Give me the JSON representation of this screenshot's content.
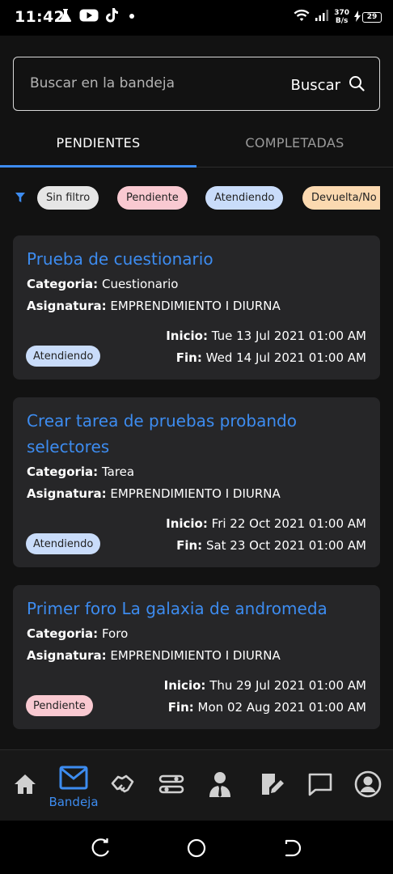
{
  "status_bar": {
    "time": "11:42",
    "net_speed_value": "370",
    "net_speed_unit": "B/s",
    "battery": "29",
    "icons": [
      "flask-icon",
      "youtube-icon",
      "tiktok-icon",
      "dot-icon",
      "wifi-icon",
      "signal-icon",
      "charging-icon",
      "battery-icon"
    ]
  },
  "search": {
    "placeholder": "Buscar en la bandeja",
    "button_label": "Buscar"
  },
  "tabs": [
    {
      "label": "PENDIENTES",
      "active": true
    },
    {
      "label": "COMPLETADAS",
      "active": false
    }
  ],
  "filters": [
    {
      "label": "Sin filtro",
      "color": "#e6e6e6"
    },
    {
      "label": "Pendiente",
      "color": "#f9c9d1"
    },
    {
      "label": "Atendiendo",
      "color": "#c9dcfa"
    },
    {
      "label": "Devuelta/No r",
      "color": "#fbd9b0"
    }
  ],
  "labels": {
    "categoria": "Categoria:",
    "asignatura": "Asignatura:",
    "inicio": "Inicio:",
    "fin": "Fin:"
  },
  "cards": [
    {
      "title": "Prueba de cuestionario",
      "categoria": "Cuestionario",
      "asignatura": "EMPRENDIMIENTO I DIURNA",
      "inicio": "Tue 13 Jul 2021 01:00 AM",
      "fin": "Wed 14 Jul 2021 01:00 AM",
      "status": "Atendiendo",
      "status_color": "#c9dcfa"
    },
    {
      "title": "Crear tarea de pruebas probando selectores",
      "categoria": "Tarea",
      "asignatura": "EMPRENDIMIENTO I DIURNA",
      "inicio": "Fri 22 Oct 2021 01:00 AM",
      "fin": "Sat 23 Oct 2021 01:00 AM",
      "status": "Atendiendo",
      "status_color": "#c9dcfa"
    },
    {
      "title": "Primer foro La galaxia de andromeda",
      "categoria": "Foro",
      "asignatura": "EMPRENDIMIENTO I DIURNA",
      "inicio": "Thu 29 Jul 2021 01:00 AM",
      "fin": "Mon 02 Aug 2021 01:00 AM",
      "status": "Pendiente",
      "status_color": "#f9c9d1"
    }
  ],
  "bottom_nav": {
    "active_label": "Bandeja",
    "items": [
      "home-icon",
      "inbox-icon",
      "handshake-icon",
      "settings-sliders-icon",
      "teacher-icon",
      "notes-edit-icon",
      "chat-icon",
      "profile-icon"
    ]
  },
  "colors": {
    "accent": "#3d8cf0",
    "background": "#121212",
    "card": "#262628"
  }
}
